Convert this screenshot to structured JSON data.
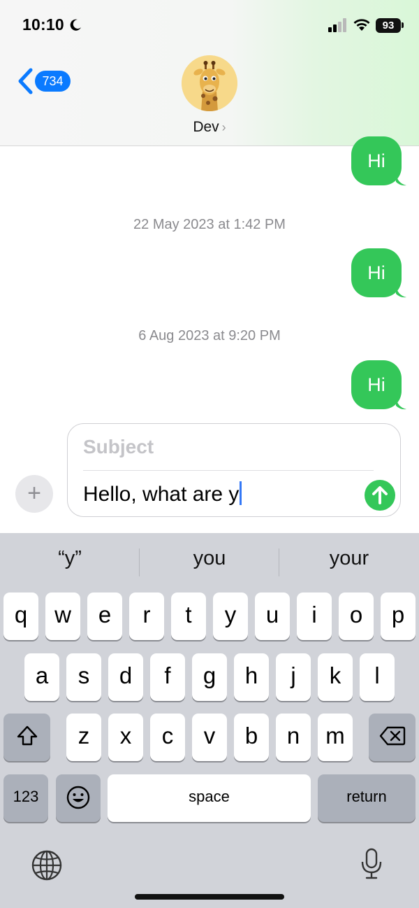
{
  "status_bar": {
    "time": "10:10",
    "battery": "93",
    "icons": [
      "moon-icon",
      "signal-icon",
      "wifi-icon",
      "battery-icon"
    ]
  },
  "header": {
    "back_badge": "734",
    "contact_name": "Dev",
    "chevron": "›"
  },
  "messages": [
    {
      "text": "Hi"
    },
    {
      "timestamp": "22 May 2023 at 1:42 PM",
      "text": "Hi"
    },
    {
      "timestamp": "6 Aug 2023 at 9:20 PM",
      "text": "Hi"
    }
  ],
  "composer": {
    "plus": "+",
    "subject_placeholder": "Subject",
    "message_text": "Hello, what are y"
  },
  "keyboard": {
    "suggestions": [
      "“y”",
      "you",
      "your"
    ],
    "row1": [
      "q",
      "w",
      "e",
      "r",
      "t",
      "y",
      "u",
      "i",
      "o",
      "p"
    ],
    "row2": [
      "a",
      "s",
      "d",
      "f",
      "g",
      "h",
      "j",
      "k",
      "l"
    ],
    "row3": [
      "z",
      "x",
      "c",
      "v",
      "b",
      "n",
      "m"
    ],
    "numbers_label": "123",
    "space_label": "space",
    "return_label": "return"
  },
  "colors": {
    "imessage_green": "#34c759",
    "ios_blue": "#0a7aff",
    "keyboard_bg": "#d1d3d9"
  }
}
